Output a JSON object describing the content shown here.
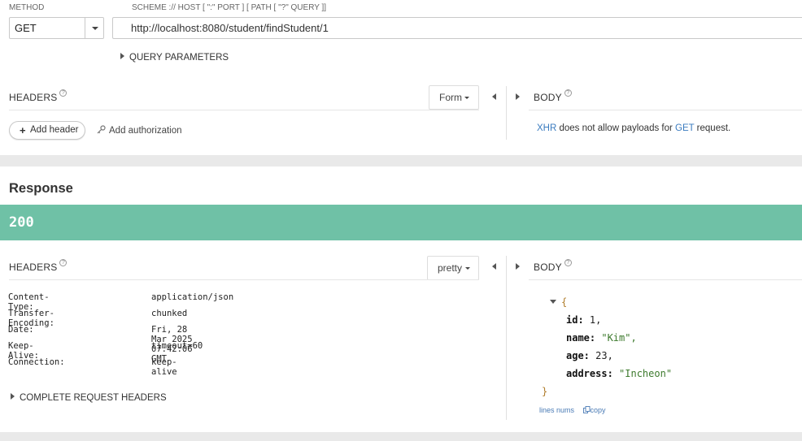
{
  "request": {
    "method_label": "METHOD",
    "method_value": "GET",
    "url_label": "SCHEME :// HOST [ \":\" PORT ] [ PATH [ \"?\" QUERY ]]",
    "url_value": "http://localhost:8080/student/findStudent/1",
    "query_params_label": "QUERY PARAMETERS",
    "headers_title": "HEADERS",
    "headers_mode": "Form",
    "add_header_label": "Add header",
    "add_authorization_label": "Add authorization",
    "body_title": "BODY",
    "body_message": {
      "part1": "XHR",
      "part2": " does not allow payloads for ",
      "part3": "GET",
      "part4": " request."
    }
  },
  "response": {
    "title": "Response",
    "status_code": "200",
    "status_color": "#6fc1a6",
    "headers_title": "HEADERS",
    "headers_mode": "pretty",
    "headers": [
      {
        "name": "Content-Type:",
        "value": "application/json"
      },
      {
        "name": "Transfer-Encoding:",
        "value": "chunked"
      },
      {
        "name": "Date:",
        "value": "Fri, 28 Mar 2025 07:42:06 GMT"
      },
      {
        "name": "Keep-Alive:",
        "value": "timeout=60"
      },
      {
        "name": "Connection:",
        "value": "keep-alive"
      }
    ],
    "complete_headers_label": "COMPLETE REQUEST HEADERS",
    "body_title": "BODY",
    "json_open": "{",
    "json_close": "}",
    "json_fields": [
      {
        "key": "id:",
        "value": "1,",
        "type": "num"
      },
      {
        "key": "name:",
        "value": "\"Kim\",",
        "type": "str"
      },
      {
        "key": "age:",
        "value": "23,",
        "type": "num"
      },
      {
        "key": "address:",
        "value": "\"Incheon\"",
        "type": "str"
      }
    ],
    "lines_nums_label": "lines nums",
    "copy_label": "copy"
  }
}
